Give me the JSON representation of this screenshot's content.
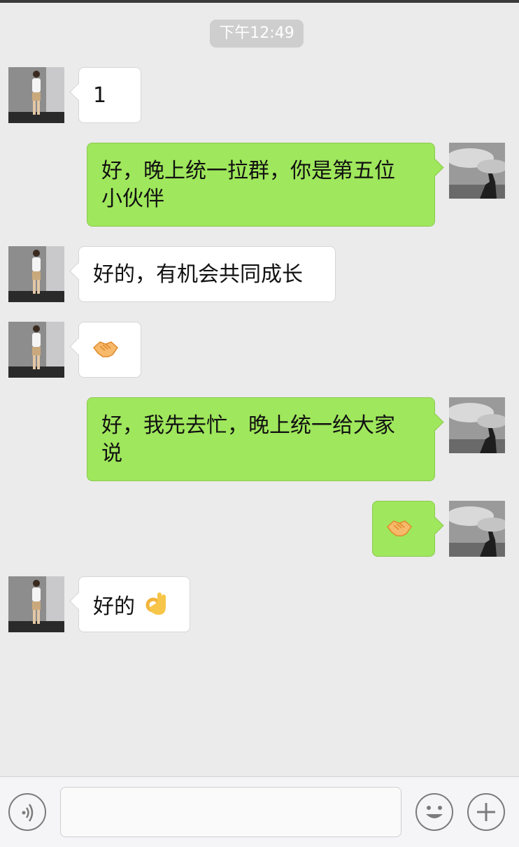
{
  "chat": {
    "timestamp": "下午12:49",
    "messages": [
      {
        "side": "left",
        "text": "1"
      },
      {
        "side": "right",
        "text": "好，晚上统一拉群，你是第五位",
        "text2": "小伙伴"
      },
      {
        "side": "left",
        "text": "好的，有机会共同成长"
      },
      {
        "side": "left",
        "emoji": "handshake-emoji"
      },
      {
        "side": "right",
        "text": "好，我先去忙，晚上统一给大家",
        "text2": "说"
      },
      {
        "side": "right",
        "emoji": "handshake-emoji"
      },
      {
        "side": "left",
        "text": "好的",
        "emoji": "ok-hand-emoji"
      }
    ]
  },
  "input_bar": {
    "icons": [
      "voice-icon",
      "emoji-icon",
      "plus-icon"
    ]
  },
  "colors": {
    "background": "#ebebeb",
    "sent_bubble": "#9fe75c",
    "received_bubble": "#ffffff"
  }
}
